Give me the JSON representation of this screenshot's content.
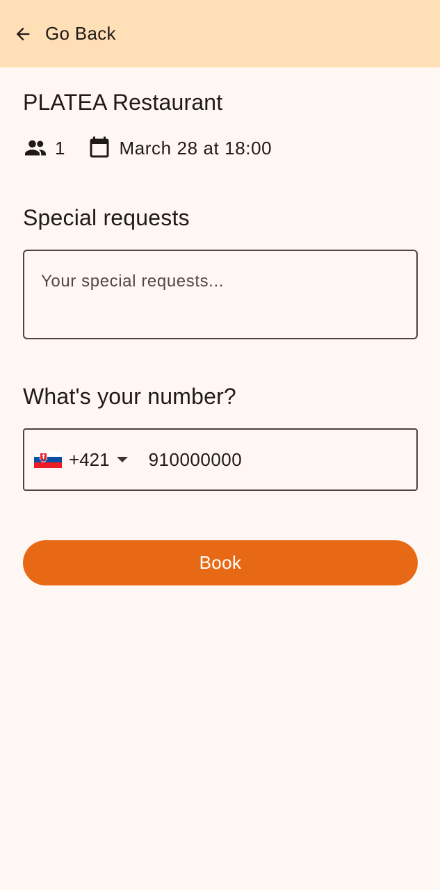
{
  "header": {
    "back_label": "Go Back",
    "back_icon": "arrow-left-icon"
  },
  "restaurant": {
    "name": "PLATEA Restaurant",
    "guests": "1",
    "guests_icon": "people-icon",
    "date_icon": "calendar-icon",
    "datetime": "March 28 at 18:00"
  },
  "special_requests": {
    "title": "Special requests",
    "placeholder": "Your special requests..."
  },
  "phone": {
    "title": "What's your number?",
    "country_flag": "slovakia-flag",
    "country_code": "+421",
    "number": "910000000"
  },
  "actions": {
    "book_label": "Book"
  },
  "colors": {
    "header_bg": "#ffdfb5",
    "page_bg": "#fff7f3",
    "accent": "#e86915"
  }
}
